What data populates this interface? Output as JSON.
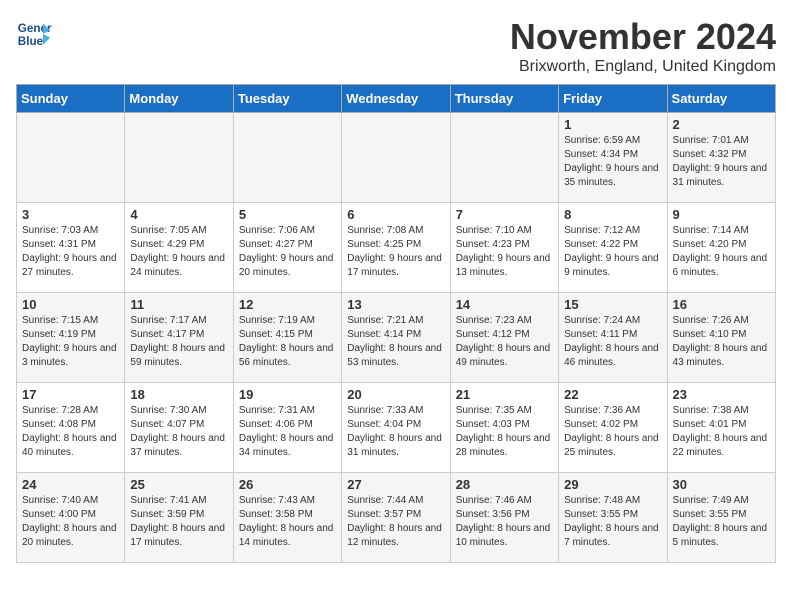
{
  "logo": {
    "line1": "General",
    "line2": "Blue"
  },
  "title": "November 2024",
  "location": "Brixworth, England, United Kingdom",
  "weekdays": [
    "Sunday",
    "Monday",
    "Tuesday",
    "Wednesday",
    "Thursday",
    "Friday",
    "Saturday"
  ],
  "weeks": [
    [
      {
        "day": "",
        "info": ""
      },
      {
        "day": "",
        "info": ""
      },
      {
        "day": "",
        "info": ""
      },
      {
        "day": "",
        "info": ""
      },
      {
        "day": "",
        "info": ""
      },
      {
        "day": "1",
        "info": "Sunrise: 6:59 AM\nSunset: 4:34 PM\nDaylight: 9 hours and 35 minutes."
      },
      {
        "day": "2",
        "info": "Sunrise: 7:01 AM\nSunset: 4:32 PM\nDaylight: 9 hours and 31 minutes."
      }
    ],
    [
      {
        "day": "3",
        "info": "Sunrise: 7:03 AM\nSunset: 4:31 PM\nDaylight: 9 hours and 27 minutes."
      },
      {
        "day": "4",
        "info": "Sunrise: 7:05 AM\nSunset: 4:29 PM\nDaylight: 9 hours and 24 minutes."
      },
      {
        "day": "5",
        "info": "Sunrise: 7:06 AM\nSunset: 4:27 PM\nDaylight: 9 hours and 20 minutes."
      },
      {
        "day": "6",
        "info": "Sunrise: 7:08 AM\nSunset: 4:25 PM\nDaylight: 9 hours and 17 minutes."
      },
      {
        "day": "7",
        "info": "Sunrise: 7:10 AM\nSunset: 4:23 PM\nDaylight: 9 hours and 13 minutes."
      },
      {
        "day": "8",
        "info": "Sunrise: 7:12 AM\nSunset: 4:22 PM\nDaylight: 9 hours and 9 minutes."
      },
      {
        "day": "9",
        "info": "Sunrise: 7:14 AM\nSunset: 4:20 PM\nDaylight: 9 hours and 6 minutes."
      }
    ],
    [
      {
        "day": "10",
        "info": "Sunrise: 7:15 AM\nSunset: 4:19 PM\nDaylight: 9 hours and 3 minutes."
      },
      {
        "day": "11",
        "info": "Sunrise: 7:17 AM\nSunset: 4:17 PM\nDaylight: 8 hours and 59 minutes."
      },
      {
        "day": "12",
        "info": "Sunrise: 7:19 AM\nSunset: 4:15 PM\nDaylight: 8 hours and 56 minutes."
      },
      {
        "day": "13",
        "info": "Sunrise: 7:21 AM\nSunset: 4:14 PM\nDaylight: 8 hours and 53 minutes."
      },
      {
        "day": "14",
        "info": "Sunrise: 7:23 AM\nSunset: 4:12 PM\nDaylight: 8 hours and 49 minutes."
      },
      {
        "day": "15",
        "info": "Sunrise: 7:24 AM\nSunset: 4:11 PM\nDaylight: 8 hours and 46 minutes."
      },
      {
        "day": "16",
        "info": "Sunrise: 7:26 AM\nSunset: 4:10 PM\nDaylight: 8 hours and 43 minutes."
      }
    ],
    [
      {
        "day": "17",
        "info": "Sunrise: 7:28 AM\nSunset: 4:08 PM\nDaylight: 8 hours and 40 minutes."
      },
      {
        "day": "18",
        "info": "Sunrise: 7:30 AM\nSunset: 4:07 PM\nDaylight: 8 hours and 37 minutes."
      },
      {
        "day": "19",
        "info": "Sunrise: 7:31 AM\nSunset: 4:06 PM\nDaylight: 8 hours and 34 minutes."
      },
      {
        "day": "20",
        "info": "Sunrise: 7:33 AM\nSunset: 4:04 PM\nDaylight: 8 hours and 31 minutes."
      },
      {
        "day": "21",
        "info": "Sunrise: 7:35 AM\nSunset: 4:03 PM\nDaylight: 8 hours and 28 minutes."
      },
      {
        "day": "22",
        "info": "Sunrise: 7:36 AM\nSunset: 4:02 PM\nDaylight: 8 hours and 25 minutes."
      },
      {
        "day": "23",
        "info": "Sunrise: 7:38 AM\nSunset: 4:01 PM\nDaylight: 8 hours and 22 minutes."
      }
    ],
    [
      {
        "day": "24",
        "info": "Sunrise: 7:40 AM\nSunset: 4:00 PM\nDaylight: 8 hours and 20 minutes."
      },
      {
        "day": "25",
        "info": "Sunrise: 7:41 AM\nSunset: 3:59 PM\nDaylight: 8 hours and 17 minutes."
      },
      {
        "day": "26",
        "info": "Sunrise: 7:43 AM\nSunset: 3:58 PM\nDaylight: 8 hours and 14 minutes."
      },
      {
        "day": "27",
        "info": "Sunrise: 7:44 AM\nSunset: 3:57 PM\nDaylight: 8 hours and 12 minutes."
      },
      {
        "day": "28",
        "info": "Sunrise: 7:46 AM\nSunset: 3:56 PM\nDaylight: 8 hours and 10 minutes."
      },
      {
        "day": "29",
        "info": "Sunrise: 7:48 AM\nSunset: 3:55 PM\nDaylight: 8 hours and 7 minutes."
      },
      {
        "day": "30",
        "info": "Sunrise: 7:49 AM\nSunset: 3:55 PM\nDaylight: 8 hours and 5 minutes."
      }
    ]
  ]
}
